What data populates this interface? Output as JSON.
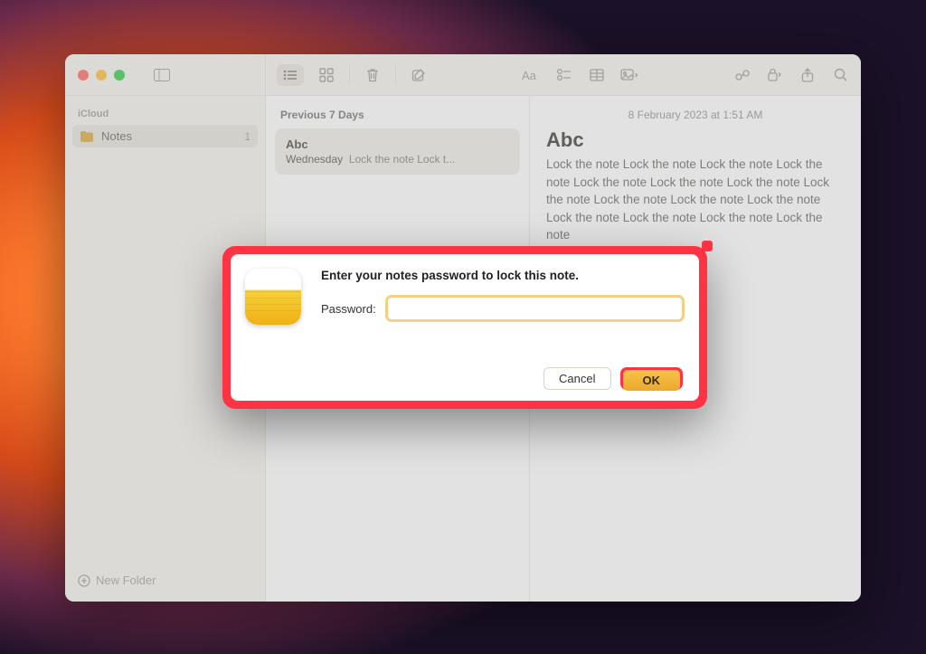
{
  "sidebar": {
    "section_label": "iCloud",
    "items": [
      {
        "label": "Notes",
        "count": "1"
      }
    ],
    "new_folder_label": "New Folder"
  },
  "notes_list": {
    "section_label": "Previous 7 Days",
    "items": [
      {
        "title": "Abc",
        "day": "Wednesday",
        "preview": "Lock the note Lock t..."
      }
    ]
  },
  "editor": {
    "timestamp": "8 February 2023 at 1:51 AM",
    "title": "Abc",
    "body": "Lock the note Lock the note Lock the note Lock the note Lock the note Lock the note Lock the note Lock the note Lock the note Lock the note Lock the note Lock the note Lock the note Lock the note Lock the note"
  },
  "dialog": {
    "title": "Enter your notes password to lock this note.",
    "password_label": "Password:",
    "password_value": "",
    "cancel_label": "Cancel",
    "ok_label": "OK"
  }
}
